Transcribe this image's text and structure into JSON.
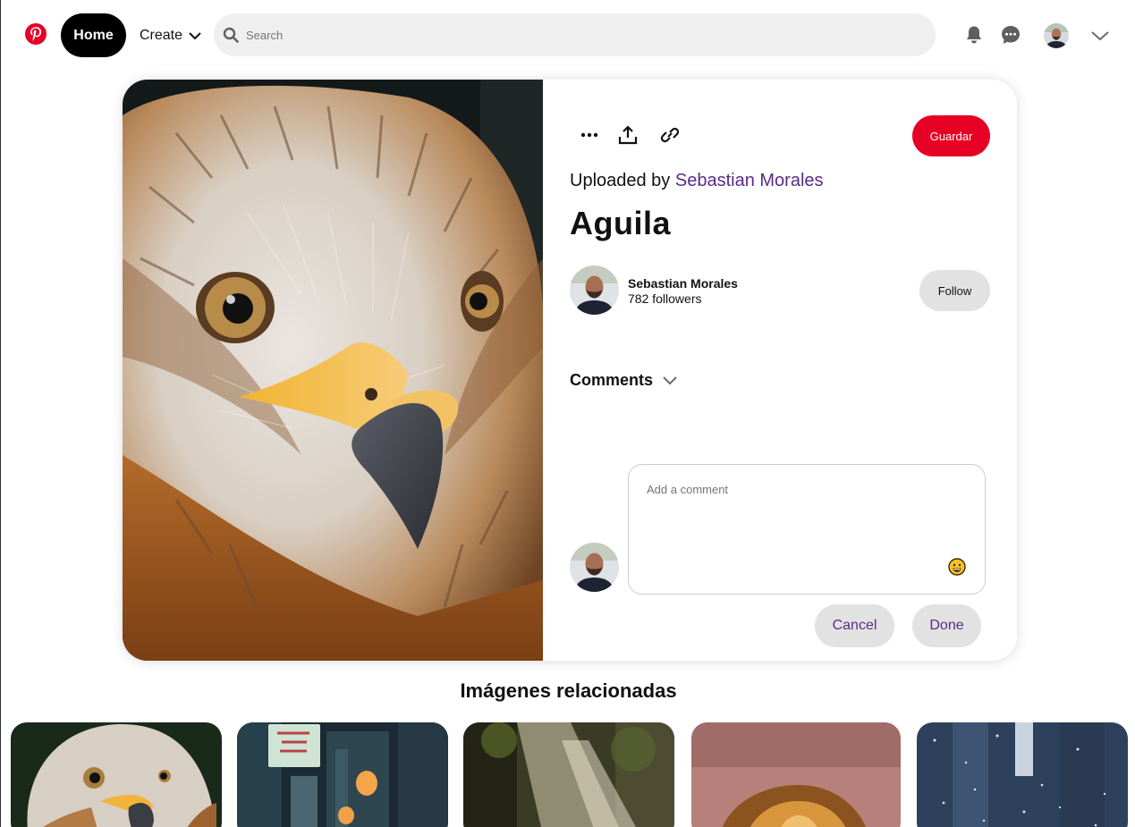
{
  "header": {
    "logo_icon": "pinterest-logo-icon",
    "home_label": "Home",
    "create_label": "Create",
    "search_placeholder": "Search",
    "search_value": "",
    "icons": [
      "bell-icon",
      "chat-bubble-icon",
      "avatar",
      "chevron-down-icon"
    ]
  },
  "pin": {
    "image_alt": "Aguila",
    "toolbar_icons": [
      "more-dots-icon",
      "share-upload-icon",
      "link-icon"
    ],
    "save_label": "Guardar",
    "uploaded_prefix": "Uploaded by",
    "uploader_name": "Sebastian Morales",
    "title": "Aguila",
    "owner": {
      "name": "Sebastian Morales",
      "followers": "782 followers"
    },
    "follow_label": "Follow",
    "comments_label": "Comments",
    "comment_placeholder": "Add a comment",
    "comment_value": "",
    "cancel_label": "Cancel",
    "done_label": "Done"
  },
  "related": {
    "title": "Imágenes relacionadas"
  },
  "colors": {
    "brand_red": "#e60023",
    "link_purple": "#5b2a86",
    "button_grey": "#e2e2e2",
    "search_bg": "#efefef"
  }
}
